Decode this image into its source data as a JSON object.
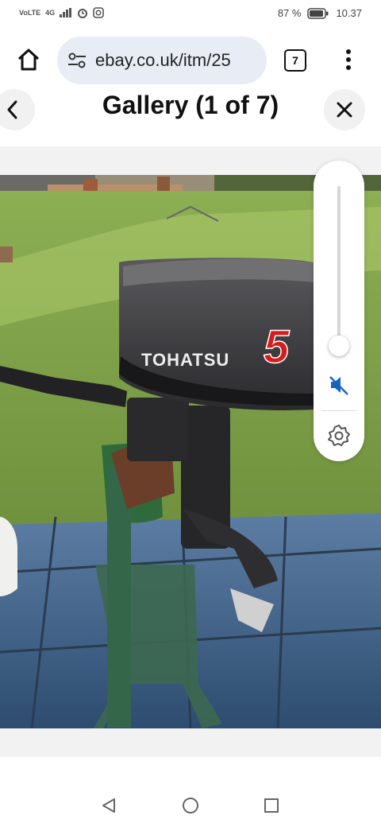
{
  "status": {
    "network": "4G",
    "battery": "87 %",
    "time": "10.37"
  },
  "browser": {
    "url": "ebay.co.uk/itm/25",
    "tab_count": "7"
  },
  "gallery": {
    "title": "Gallery (1 of 7)"
  },
  "photo": {
    "brand": "TOHATSU",
    "model_number": "5"
  },
  "volume_panel": {
    "level": 0.06,
    "muted": true
  },
  "colors": {
    "accent": "#1a73e8",
    "mute": "#1565c0",
    "brand_red": "#d81b1b"
  }
}
